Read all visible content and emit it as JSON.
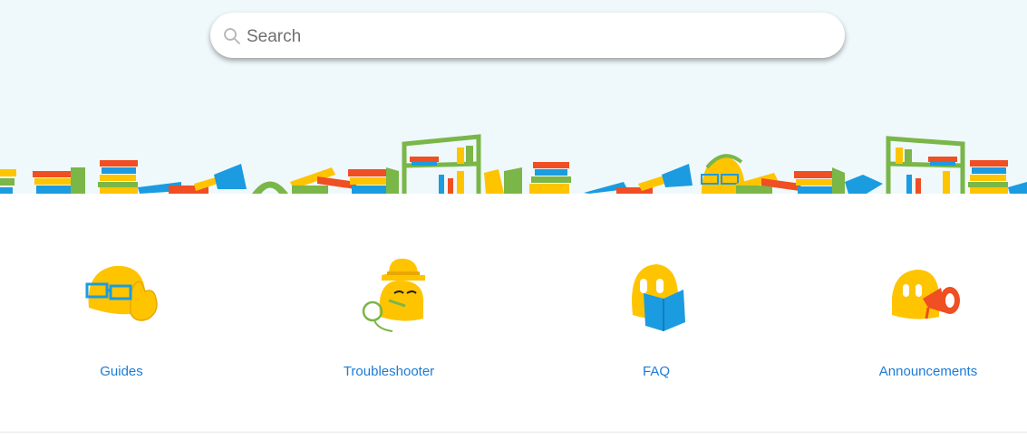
{
  "search": {
    "placeholder": "Search"
  },
  "categories": [
    {
      "label": "Guides",
      "icon": "ghost-glasses-icon"
    },
    {
      "label": "Troubleshooter",
      "icon": "ghost-detective-icon"
    },
    {
      "label": "FAQ",
      "icon": "ghost-book-icon"
    },
    {
      "label": "Announcements",
      "icon": "ghost-megaphone-icon"
    }
  ],
  "colors": {
    "hero_bg": "#eff8fb",
    "link": "#1a7cd6",
    "yellow": "#ffc400",
    "blue": "#1b9be0",
    "green": "#7ab648",
    "red": "#f04e23"
  }
}
